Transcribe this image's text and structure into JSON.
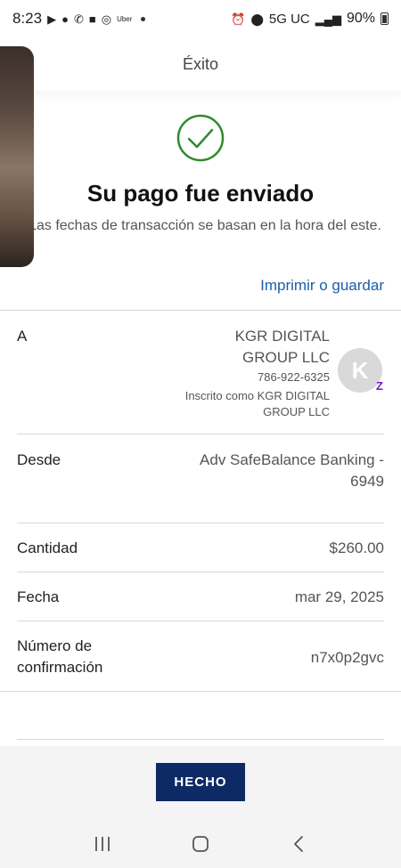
{
  "status_bar": {
    "time": "8:23",
    "uber_label": "Uber",
    "network": "5G UC",
    "battery": "90%"
  },
  "header": {
    "title": "Éxito"
  },
  "success": {
    "title": "Su pago fue enviado",
    "subtitle": "Las fechas de transacción se basan en la hora del este."
  },
  "print_link": "Imprimir o guardar",
  "details": {
    "recipient": {
      "label": "A",
      "name": "KGR DIGITAL GROUP LLC",
      "phone": "786-922-6325",
      "enrolled_as": "Inscrito como KGR DIGITAL GROUP LLC",
      "avatar_initial": "K",
      "badge": "Z"
    },
    "from": {
      "label": "Desde",
      "value": "Adv SafeBalance Banking - 6949"
    },
    "amount": {
      "label": "Cantidad",
      "value": "$260.00"
    },
    "date": {
      "label": "Fecha",
      "value": "mar 29, 2025"
    },
    "confirmation": {
      "label": "Número de confirmación",
      "value": "n7x0p2gvc"
    }
  },
  "done_button": "HECHO",
  "colors": {
    "success_green": "#2e8b2e",
    "link_blue": "#1a5ea8",
    "button_navy": "#0e2a66",
    "zelle_purple": "#6d1ed4"
  }
}
